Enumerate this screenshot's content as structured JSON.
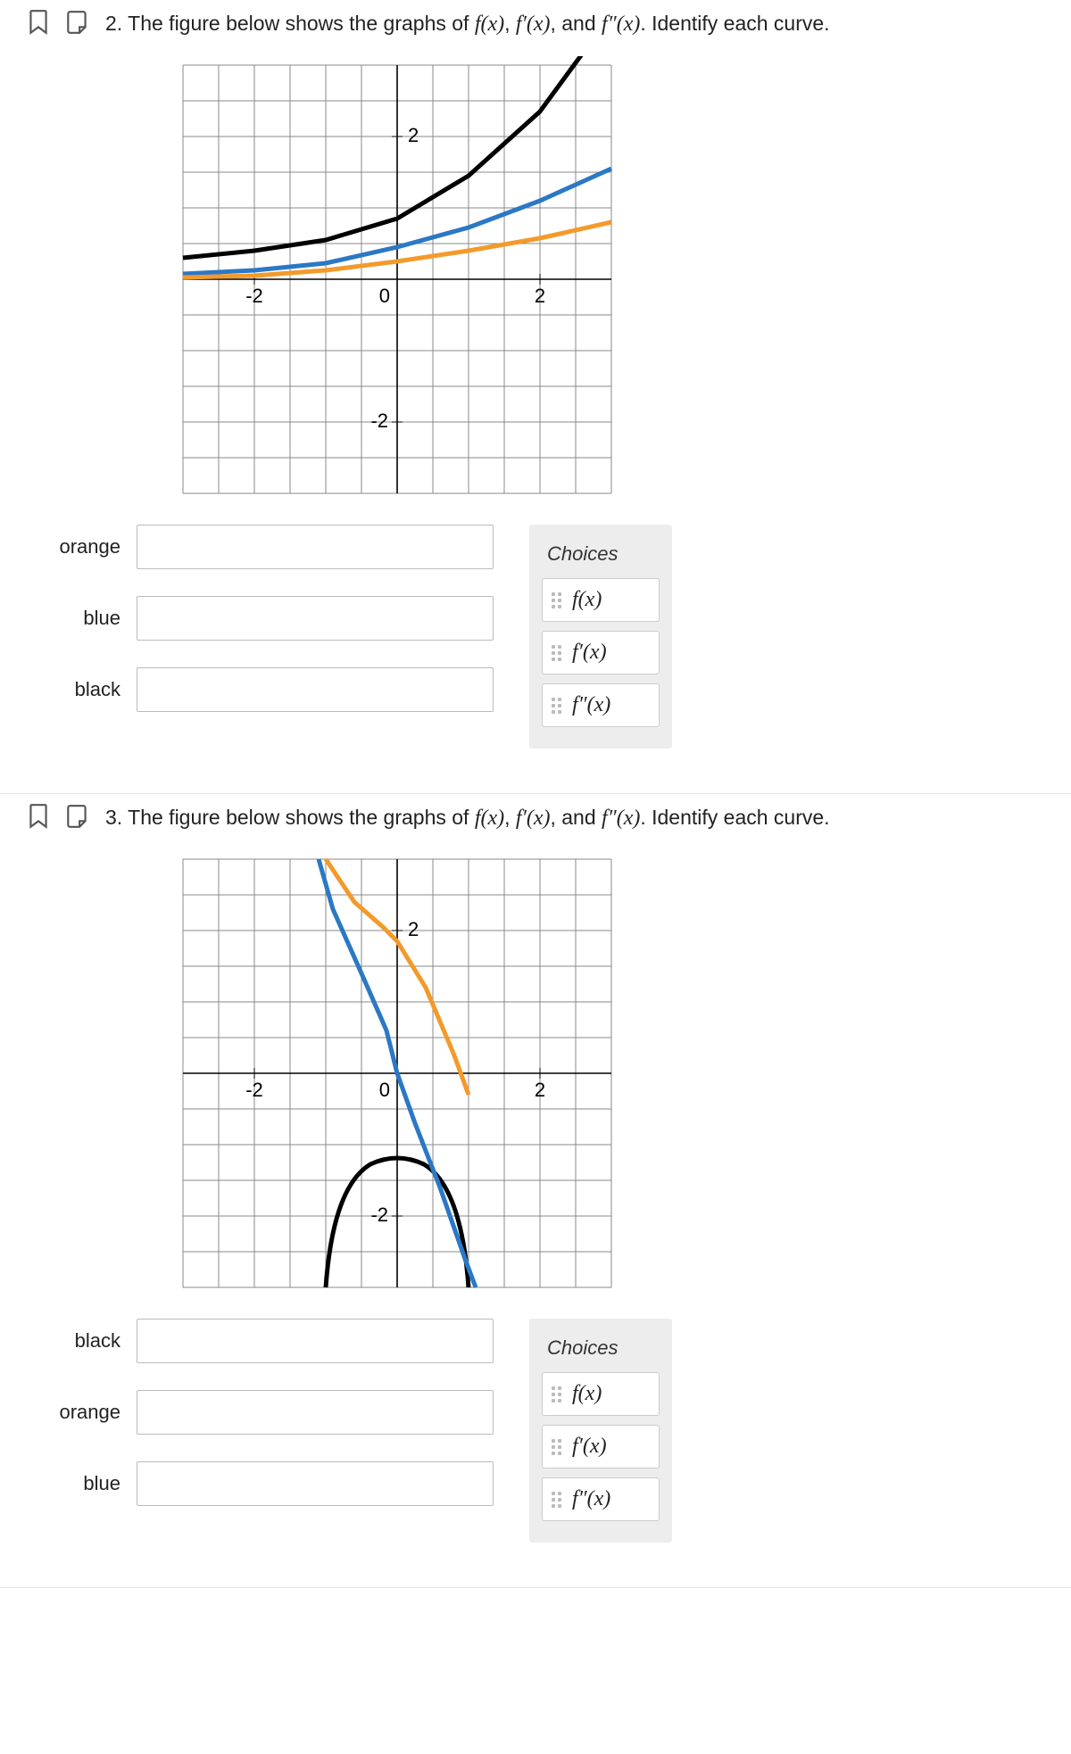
{
  "q2": {
    "number_prefix": "2. ",
    "prompt_a": "The figure below shows the graphs of ",
    "f": "f(x)",
    "fp": "f′(x)",
    "fpp": "f″(x)",
    "prompt_b": ". Identify each curve.",
    "row1_label": "orange",
    "row2_label": "blue",
    "row3_label": "black",
    "choices_title": "Choices",
    "choice1": "f(x)",
    "choice2": "f′(x)",
    "choice3": "f″(x)",
    "axis": {
      "xneg": "-2",
      "x0": "0",
      "xpos": "2",
      "ypos": "2",
      "yneg": "-2"
    }
  },
  "q3": {
    "number_prefix": "3. ",
    "prompt_a": "The figure below shows the graphs of ",
    "f": "f(x)",
    "fp": "f′(x)",
    "fpp": "f″(x)",
    "prompt_b": ". Identify each curve.",
    "row1_label": "black",
    "row2_label": "orange",
    "row3_label": "blue",
    "choices_title": "Choices",
    "choice1": "f(x)",
    "choice2": "f′(x)",
    "choice3": "f″(x)",
    "axis": {
      "xneg": "-2",
      "x0": "0",
      "xpos": "2",
      "yneg": "-2",
      "ypos": "2"
    }
  },
  "chart_data": [
    {
      "type": "line",
      "title": "",
      "xlabel": "",
      "ylabel": "",
      "xlim": [
        -3,
        3
      ],
      "ylim": [
        -3,
        3
      ],
      "x_ticks": [
        -2,
        0,
        2
      ],
      "y_ticks": [
        -2,
        0,
        2
      ],
      "grid": true,
      "series": [
        {
          "name": "black",
          "color": "#000000",
          "x": [
            -3,
            -2,
            -1,
            0,
            1,
            2,
            3
          ],
          "y": [
            0.3,
            0.4,
            0.55,
            0.85,
            1.45,
            2.35,
            3.6
          ]
        },
        {
          "name": "blue",
          "color": "#2b78c5",
          "x": [
            -3,
            -2,
            -1,
            0,
            1,
            2,
            3
          ],
          "y": [
            0.08,
            0.12,
            0.23,
            0.45,
            0.72,
            1.1,
            1.55
          ]
        },
        {
          "name": "orange",
          "color": "#f39a2b",
          "x": [
            -3,
            -2,
            -1,
            0,
            1,
            2,
            3
          ],
          "y": [
            0.03,
            0.05,
            0.12,
            0.25,
            0.4,
            0.58,
            0.8
          ]
        }
      ]
    },
    {
      "type": "line",
      "title": "",
      "xlabel": "",
      "ylabel": "",
      "xlim": [
        -3,
        3
      ],
      "ylim": [
        -3,
        3
      ],
      "x_ticks": [
        -2,
        0,
        2
      ],
      "y_ticks": [
        -2,
        0,
        2
      ],
      "grid": true,
      "series": [
        {
          "name": "black",
          "color": "#000000",
          "x": [
            -1,
            -0.6,
            -0.3,
            0,
            0.3,
            0.6,
            1
          ],
          "y": [
            -3,
            -1.9,
            -1.35,
            -1.2,
            -1.35,
            -1.9,
            -3
          ]
        },
        {
          "name": "orange",
          "color": "#f39a2b",
          "x": [
            -1,
            -0.6,
            -0.2,
            0,
            0.4,
            0.8,
            1.0
          ],
          "y": [
            3,
            2.4,
            2.05,
            1.85,
            1.2,
            0.25,
            -0.3
          ]
        },
        {
          "name": "blue",
          "color": "#2b78c5",
          "x": [
            -1.1,
            -0.9,
            -0.5,
            -0.15,
            0,
            0.25,
            0.6,
            0.95,
            1.1
          ],
          "y": [
            3,
            2.3,
            1.4,
            0.6,
            0.0,
            -0.7,
            -1.6,
            -2.6,
            -3
          ]
        }
      ]
    }
  ]
}
